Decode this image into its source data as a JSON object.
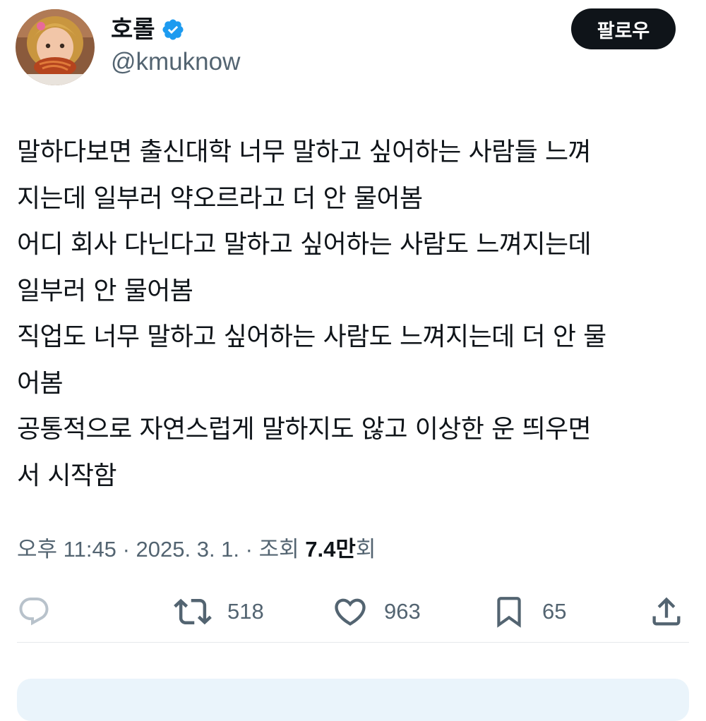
{
  "author": {
    "display_name": "호롤",
    "handle": "@kmuknow",
    "verified_icon": "verified-badge-icon"
  },
  "follow_button": {
    "label": "팔로우"
  },
  "tweet": {
    "lines": [
      "말하다보면 출신대학 너무 말하고 싶어하는 사람들 느껴",
      "지는데 일부러 약오르라고 더 안 물어봄",
      "어디 회사 다닌다고 말하고 싶어하는 사람도 느껴지는데",
      "일부러 안 물어봄",
      "직업도 너무 말하고 싶어하는 사람도 느껴지는데 더 안 물",
      "어봄",
      "공통적으로 자연스럽게 말하지도 않고 이상한 운 띄우면",
      "서 시작함"
    ]
  },
  "meta": {
    "time": "오후 11:45",
    "separator": "·",
    "date": "2025. 3. 1.",
    "views_label": "조회",
    "views_count": "7.4만",
    "views_suffix": "회"
  },
  "actions": {
    "reply": {
      "icon": "reply-icon"
    },
    "repost": {
      "icon": "repost-icon",
      "count": "518"
    },
    "like": {
      "icon": "heart-icon",
      "count": "963"
    },
    "bookmark": {
      "icon": "bookmark-icon",
      "count": "65"
    },
    "share": {
      "icon": "share-icon"
    }
  },
  "colors": {
    "text_primary": "#0f1419",
    "text_secondary": "#536471",
    "verified_blue": "#1d9bf0",
    "follow_bg": "#0f1419",
    "follow_text": "#ffffff",
    "divider": "#e6e9ec"
  }
}
